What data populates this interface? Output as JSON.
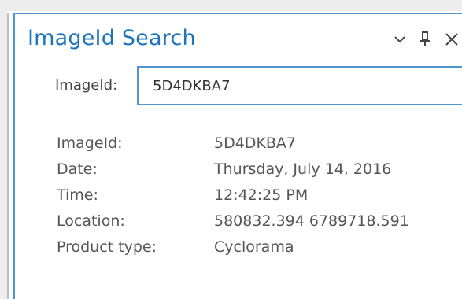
{
  "panel": {
    "title": "ImageId Search",
    "icons": {
      "menu": "chevron-down-icon",
      "pin": "pin-icon",
      "close": "close-icon"
    },
    "accent_color": "#1e73be",
    "border_color": "#4e97d4"
  },
  "search": {
    "label": "ImageId:",
    "value": "5D4DKBA7"
  },
  "details": [
    {
      "label": "ImageId:",
      "value": "5D4DKBA7"
    },
    {
      "label": "Date:",
      "value": "Thursday, July 14, 2016"
    },
    {
      "label": "Time:",
      "value": "12:42:25 PM"
    },
    {
      "label": "Location:",
      "value": "580832.394 6789718.591"
    },
    {
      "label": "Product type:",
      "value": "Cyclorama"
    }
  ]
}
